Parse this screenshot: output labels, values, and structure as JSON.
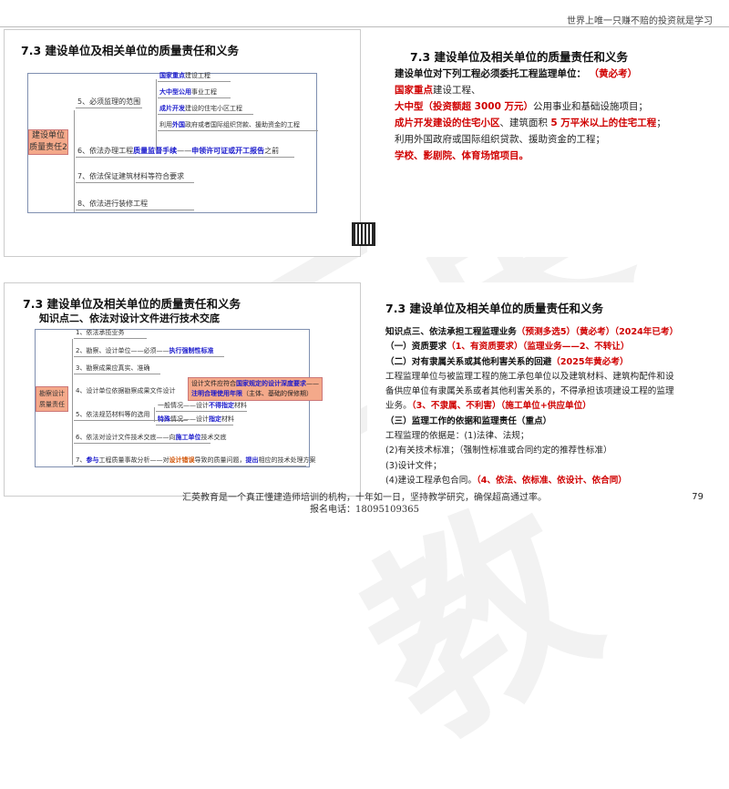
{
  "header": {
    "motto": "世界上唯一只赚不赔的投资就是学习"
  },
  "slide1": {
    "title": "7.3 建设单位及相关单位的质量责任和义务",
    "root": "建设单位质量责任2",
    "items": [
      [
        {
          "t": "5、必须监理的范围",
          "c": "n"
        }
      ],
      [
        {
          "t": "6、依法办理工程",
          "c": "n"
        },
        {
          "t": "质量监督手续",
          "c": "b"
        },
        {
          "t": "——",
          "c": "n"
        },
        {
          "t": "申领许可证或开工报告",
          "c": "b"
        },
        {
          "t": "之前",
          "c": "n"
        }
      ],
      [
        {
          "t": "7、依法保证建筑材料等符合要求",
          "c": "n"
        }
      ],
      [
        {
          "t": "8、依法进行装修工程",
          "c": "n"
        }
      ]
    ],
    "subitems": [
      [
        {
          "t": "国家重点",
          "c": "b"
        },
        {
          "t": "建设工程",
          "c": "n"
        }
      ],
      [
        {
          "t": "大中型公用",
          "c": "b"
        },
        {
          "t": "事业工程",
          "c": "n"
        }
      ],
      [
        {
          "t": "成片开发",
          "c": "b"
        },
        {
          "t": "建设的住宅小区工程",
          "c": "n"
        }
      ],
      [
        {
          "t": "利用",
          "c": "n"
        },
        {
          "t": "外国",
          "c": "b"
        },
        {
          "t": "政府或者国际组织贷款、援助资金的工程",
          "c": "n"
        }
      ]
    ]
  },
  "slide2": {
    "title": "7.3 建设单位及相关单位的质量责任和义务",
    "lines": [
      [
        {
          "t": "建设单位对下列工程必须委托工程监理单位：",
          "c": "k"
        },
        {
          "t": "  （黄必考）",
          "c": "r"
        }
      ],
      [
        {
          "t": "国家重点",
          "c": "r"
        },
        {
          "t": "建设工程、",
          "c": "n"
        }
      ],
      [
        {
          "t": "大中型（投资额超 3000 万元）",
          "c": "r"
        },
        {
          "t": "公用事业和基础设施项目；",
          "c": "n"
        }
      ],
      [
        {
          "t": "成片开发建设的住宅小区",
          "c": "r"
        },
        {
          "t": "、建筑面积 ",
          "c": "n"
        },
        {
          "t": "5 万平米以上的住宅工程",
          "c": "r"
        },
        {
          "t": "；",
          "c": "n"
        }
      ],
      [
        {
          "t": "利用外国政府或国际组织贷款、援助资金的工程；",
          "c": "n"
        }
      ],
      [
        {
          "t": "学校、影剧院、体育场馆项目。",
          "c": "r"
        }
      ]
    ]
  },
  "slide3": {
    "title": "7.3 建设单位及相关单位的质量责任和义务",
    "subtitle": "知识点二、依法对设计文件进行技术交底",
    "root": "勘察设计质量责任",
    "items": [
      [
        {
          "t": "1、依法承揽业务",
          "c": "n"
        }
      ],
      [
        {
          "t": "2、勘察、设计单位——必须——",
          "c": "n"
        },
        {
          "t": "执行强制性标准",
          "c": "b"
        }
      ],
      [
        {
          "t": "3、勘察成果应真实、准确",
          "c": "n"
        }
      ],
      [
        {
          "t": "4、设计单位依据勘察成果文件设计",
          "c": "n"
        }
      ],
      [
        {
          "t": "5、依法规范材料等的选用",
          "c": "n"
        }
      ],
      [
        {
          "t": "6、依法对设计文件技术交底——向",
          "c": "n"
        },
        {
          "t": "施工单位",
          "c": "b"
        },
        {
          "t": "技术交底",
          "c": "n"
        }
      ],
      [
        {
          "t": "7、",
          "c": "n"
        },
        {
          "t": "参与",
          "c": "b"
        },
        {
          "t": "工程质量事故分析——对",
          "c": "n"
        },
        {
          "t": "设计错误",
          "c": "o"
        },
        {
          "t": "导致的质量问题，",
          "c": "n"
        },
        {
          "t": "提出",
          "c": "b"
        },
        {
          "t": "相应的技术处理方案",
          "c": "n"
        }
      ]
    ],
    "highlight": [
      [
        {
          "t": "设计文件应符合",
          "c": "n"
        },
        {
          "t": "国家规定的设计深度要求",
          "c": "b"
        },
        {
          "t": "——",
          "c": "n"
        }
      ],
      [
        {
          "t": "注明合理使用年限",
          "c": "b"
        },
        {
          "t": "（主体、基础的保修期）",
          "c": "n"
        }
      ]
    ],
    "subitems": [
      [
        {
          "t": "一般情况——设计",
          "c": "n"
        },
        {
          "t": "不得指定",
          "c": "b"
        },
        {
          "t": "材料",
          "c": "n"
        }
      ],
      [
        {
          "t": "特殊",
          "c": "b"
        },
        {
          "t": "情况——设计",
          "c": "n"
        },
        {
          "t": "指定",
          "c": "b"
        },
        {
          "t": "材料",
          "c": "n"
        }
      ]
    ]
  },
  "slide4": {
    "title": "7.3 建设单位及相关单位的质量责任和义务",
    "lines": [
      [
        {
          "t": "知识点三、依法承担工程监理业务",
          "c": "k"
        },
        {
          "t": "（预测多选5）（黄必考）（2024年已考）",
          "c": "r"
        }
      ],
      [
        {
          "t": " （一）资质要求",
          "c": "k"
        },
        {
          "t": "（1、有资质要求）（监理业务——2、不转让）",
          "c": "r"
        }
      ],
      [
        {
          "t": " （二）对有隶属关系或其他利害关系的回避",
          "c": "k"
        },
        {
          "t": "（2025年黄必考）",
          "c": "r"
        }
      ],
      [
        {
          "t": "工程监理单位与被监理工程的施工承包单位以及建筑材料、建筑构配件和设",
          "c": "n"
        }
      ],
      [
        {
          "t": "备供应单位有隶属关系或者其他利害关系的，不得承担该项建设工程的监理",
          "c": "n"
        }
      ],
      [
        {
          "t": "业务。",
          "c": "n"
        },
        {
          "t": "（3、不隶属、不利害）（施工单位+供应单位）",
          "c": "r"
        }
      ],
      [
        {
          "t": " （三）监理工作的依据和监理责任（重点）",
          "c": "k"
        }
      ],
      [
        {
          "t": "工程监理的依据是：(1)法律、法规；",
          "c": "n"
        }
      ],
      [
        {
          "t": "(2)有关技术标准；（强制性标准或合同约定的推荐性标准）",
          "c": "n"
        }
      ],
      [
        {
          "t": "(3)设计文件；",
          "c": "n"
        }
      ],
      [
        {
          "t": "(4)建设工程承包合同。",
          "c": "n"
        },
        {
          "t": "（4、依法、依标准、依设计、依合同）",
          "c": "r"
        }
      ]
    ]
  },
  "footer": {
    "line1": "汇英教育是一个真正懂建造师培训的机构，十年如一日，坚持教学研究，确保超高通过率。",
    "line2": "报名电话：18095109365",
    "page": "79"
  }
}
